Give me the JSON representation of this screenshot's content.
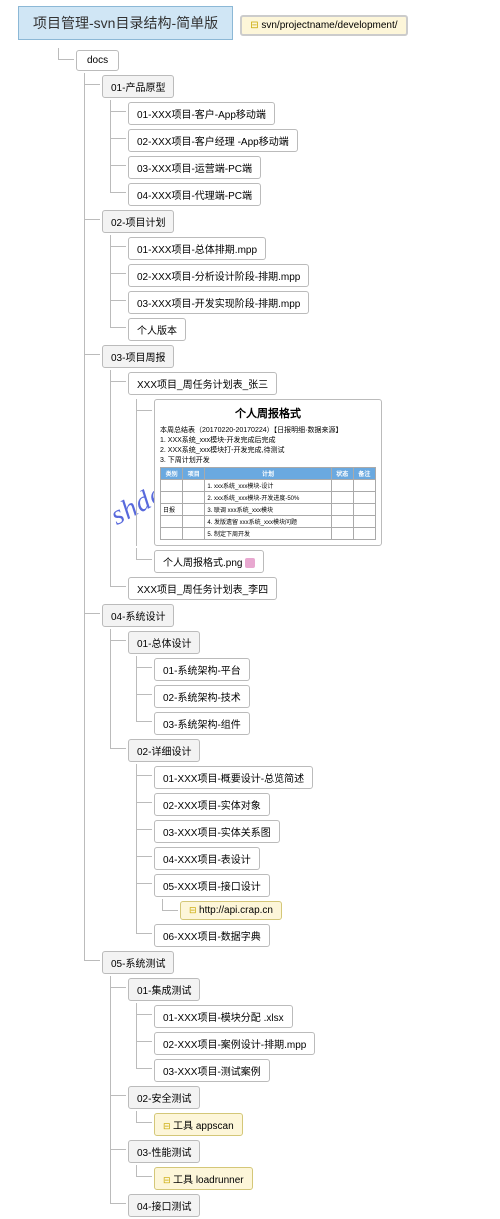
{
  "title": "项目管理-svn目录结构-简单版",
  "root_path": "svn/projectname/development/",
  "watermark": "shdeipmp-guixuan",
  "docs": {
    "label": "docs",
    "sections": {
      "s01": {
        "label": "01-产品原型",
        "items": [
          "01-XXX项目-客户-App移动端",
          "02-XXX项目-客户经理 -App移动端",
          "03-XXX项目-运营端-PC端",
          "04-XXX项目-代理端-PC端"
        ]
      },
      "s02": {
        "label": "02-项目计划",
        "items": [
          "01-XXX项目-总体排期.mpp",
          "02-XXX项目-分析设计阶段-排期.mpp",
          "03-XXX项目-开发实现阶段-排期.mpp",
          "个人版本"
        ]
      },
      "s03": {
        "label": "03-项目周报",
        "child": "XXX项目_周任务计划表_张三",
        "preview": {
          "title": "个人周报格式",
          "header": "本周总结表（20170220-20170224）【日报明细·数据来源】",
          "bullets": [
            "1. XXX系统_xxx模块-开发完成后完成",
            "2. XXX系统_xxx模块打-开发完成,待测试",
            "3. 下周计划开发"
          ],
          "cols": [
            "类别",
            "项目",
            "计划",
            "状态",
            "备注"
          ],
          "rows": [
            [
              "",
              "",
              "1. xxx系统_xxx模块-设计",
              "",
              ""
            ],
            [
              "",
              "",
              "2. xxx系统_xxx模块-开发进度-50%",
              "",
              ""
            ],
            [
              "日报",
              "",
              "3. 联调 xxx系统_xxx模块",
              "",
              ""
            ],
            [
              "",
              "",
              "4. 发版遗留 xxx系统_xxx模块问题",
              "",
              ""
            ],
            [
              "",
              "",
              "5. 制定下周开发",
              "",
              ""
            ]
          ],
          "file": "个人周报格式.png"
        },
        "child2": "XXX项目_周任务计划表_李四"
      },
      "s04": {
        "label": "04-系统设计",
        "overall": {
          "label": "01-总体设计",
          "items": [
            "01-系统架构-平台",
            "02-系统架构-技术",
            "03-系统架构-组件"
          ]
        },
        "detail": {
          "label": "02-详细设计",
          "items": [
            "01-XXX项目-概要设计-总览简述",
            "02-XXX项目-实体对象",
            "03-XXX项目-实体关系图",
            "04-XXX项目-表设计",
            "05-XXX项目-接口设计"
          ],
          "note": "http://api.crap.cn",
          "last": "06-XXX项目-数据字典"
        }
      },
      "s05": {
        "label": "05-系统测试",
        "integration": {
          "label": "01-集成测试",
          "items": [
            "01-XXX项目-模块分配 .xlsx",
            "02-XXX项目-案例设计-排期.mpp",
            "03-XXX项目-测试案例"
          ]
        },
        "security": {
          "label": "02-安全测试",
          "note": "工具 appscan"
        },
        "perf": {
          "label": "03-性能测试",
          "note": "工具 loadrunner"
        },
        "api": {
          "label": "04-接口测试"
        }
      }
    }
  }
}
